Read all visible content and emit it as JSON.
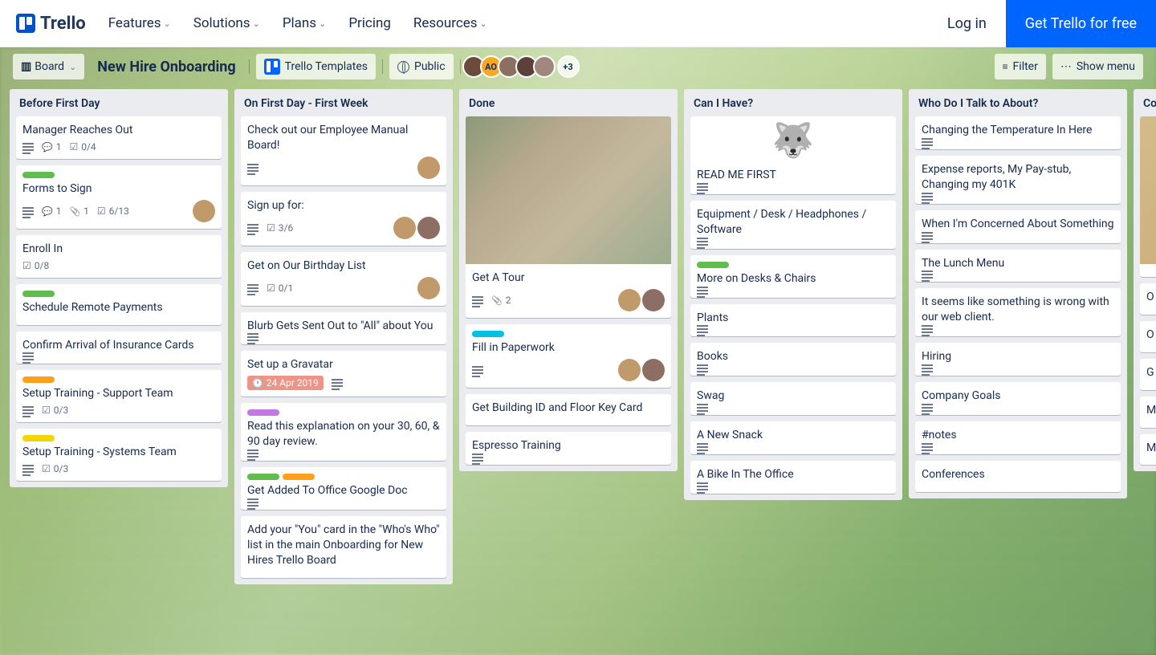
{
  "nav": {
    "brand": "Trello",
    "items": [
      "Features",
      "Solutions",
      "Plans",
      "Pricing",
      "Resources"
    ],
    "login": "Log in",
    "cta": "Get Trello for free"
  },
  "boardHeader": {
    "boardBtn": "Board",
    "title": "New Hire Onboarding",
    "templates": "Trello Templates",
    "visibility": "Public",
    "avatarInitials": "AO",
    "extraCount": "+3",
    "filter": "Filter",
    "menu": "Show menu"
  },
  "lists": [
    {
      "title": "Before First Day",
      "cards": [
        {
          "title": "Manager Reaches Out",
          "badges": {
            "desc": true,
            "comments": "1",
            "check": "0/4"
          }
        },
        {
          "labels": [
            "green"
          ],
          "title": "Forms to Sign",
          "badges": {
            "desc": true,
            "comments": "1",
            "attach": "1",
            "check": "6/13"
          },
          "members": 1
        },
        {
          "title": "Enroll In",
          "badges": {
            "check": "0/8"
          }
        },
        {
          "labels": [
            "green"
          ],
          "title": "Schedule Remote Payments"
        },
        {
          "title": "Confirm Arrival of Insurance Cards",
          "badges": {
            "desc": true
          }
        },
        {
          "labels": [
            "orange"
          ],
          "title": "Setup Training - Support Team",
          "badges": {
            "desc": true,
            "check": "0/3"
          }
        },
        {
          "labels": [
            "yellow"
          ],
          "title": "Setup Training - Systems Team",
          "badges": {
            "desc": true,
            "check": "0/3"
          }
        }
      ]
    },
    {
      "title": "On First Day - First Week",
      "cards": [
        {
          "title": "Check out our Employee Manual Board!",
          "badges": {
            "desc": true
          },
          "members": 1
        },
        {
          "title": "Sign up for:",
          "badges": {
            "desc": true,
            "check": "3/6"
          },
          "members": 2
        },
        {
          "title": "Get on Our Birthday List",
          "badges": {
            "desc": true,
            "check": "0/1"
          },
          "members": 1
        },
        {
          "title": "Blurb Gets Sent Out to \"All\" about You",
          "badges": {
            "desc": true
          }
        },
        {
          "title": "Set up a Gravatar",
          "badges": {
            "date": "24 Apr 2019",
            "desc": true
          }
        },
        {
          "labels": [
            "purple"
          ],
          "title": "Read this explanation on your 30, 60, & 90 day review.",
          "badges": {
            "desc": true
          }
        },
        {
          "labels": [
            "green",
            "orange"
          ],
          "title": "Get Added To Office Google Doc",
          "badges": {
            "desc": true
          }
        },
        {
          "title": "Add your \"You\" card in the \"Who's Who\" list in the main Onboarding for New Hires Trello Board"
        }
      ]
    },
    {
      "title": "Done",
      "cards": [
        {
          "cover": true,
          "title": "Get A Tour",
          "badges": {
            "desc": true,
            "attach": "2"
          },
          "members": 2
        },
        {
          "labels": [
            "sky"
          ],
          "title": "Fill in Paperwork",
          "badges": {
            "desc": true
          },
          "members": 2
        },
        {
          "title": "Get Building ID and Floor Key Card"
        },
        {
          "title": "Espresso Training",
          "badges": {
            "desc": true
          }
        }
      ]
    },
    {
      "title": "Can I Have?",
      "cards": [
        {
          "sticker": "🐺",
          "title": "READ ME FIRST",
          "badges": {
            "desc": true
          }
        },
        {
          "title": "Equipment / Desk / Headphones / Software",
          "badges": {
            "desc": true
          }
        },
        {
          "labels": [
            "green"
          ],
          "title": "More on Desks & Chairs",
          "badges": {
            "desc": true
          }
        },
        {
          "title": "Plants",
          "badges": {
            "desc": true
          }
        },
        {
          "title": "Books",
          "badges": {
            "desc": true
          }
        },
        {
          "title": "Swag",
          "badges": {
            "desc": true
          }
        },
        {
          "title": "A New Snack",
          "badges": {
            "desc": true
          }
        },
        {
          "title": "A Bike In The Office",
          "badges": {
            "desc": true
          }
        }
      ]
    },
    {
      "title": "Who Do I Talk to About?",
      "cards": [
        {
          "title": "Changing the Temperature In Here",
          "badges": {
            "desc": true
          }
        },
        {
          "title": "Expense reports, My Pay-stub, Changing my 401K",
          "badges": {
            "desc": true
          }
        },
        {
          "title": "When I'm Concerned About Something",
          "badges": {
            "desc": true
          }
        },
        {
          "title": "The Lunch Menu",
          "badges": {
            "desc": true
          }
        },
        {
          "title": "It seems like something is wrong with our web client.",
          "badges": {
            "desc": true
          }
        },
        {
          "title": "Hiring",
          "badges": {
            "desc": true
          }
        },
        {
          "title": "Company Goals",
          "badges": {
            "desc": true
          }
        },
        {
          "title": "#notes",
          "badges": {
            "desc": true
          }
        },
        {
          "title": "Conferences"
        }
      ]
    },
    {
      "title": "Co",
      "cards": [
        {
          "cover": true,
          "title": ""
        },
        {
          "title": "O"
        },
        {
          "title": "O"
        },
        {
          "title": "G"
        },
        {
          "title": "M"
        },
        {
          "title": "M di co"
        }
      ]
    }
  ]
}
